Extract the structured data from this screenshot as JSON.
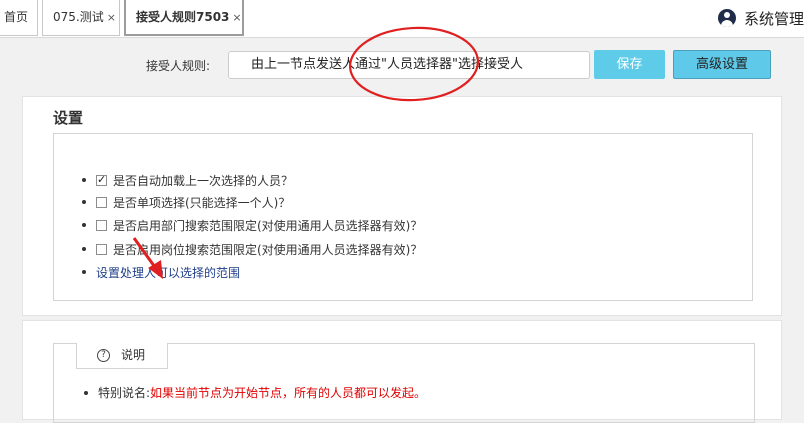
{
  "tabs": [
    {
      "label": "首页"
    },
    {
      "label": "075.测试",
      "close": "×"
    },
    {
      "label": "接受人规则7503",
      "close": "×"
    }
  ],
  "user": {
    "name": "系统管理"
  },
  "rule": {
    "label": "接受人规则:",
    "value": "由上一节点发送人通过\"人员选择器\"选择接受人"
  },
  "buttons": {
    "save": "保存",
    "advanced": "高级设置"
  },
  "settings": {
    "title": "设置",
    "options": [
      {
        "label": "是否自动加载上一次选择的人员？",
        "checked": true
      },
      {
        "label": "是否单项选择(只能选择一个人)？",
        "checked": false
      },
      {
        "label": "是否启用部门搜索范围限定(对使用通用人员选择器有效)？",
        "checked": false
      },
      {
        "label": "是否启用岗位搜索范围限定(对使用通用人员选择器有效)？",
        "checked": false
      }
    ],
    "range_link": "设置处理人可以选择的范围"
  },
  "notes": {
    "tab_label": "说明",
    "icon": "question-icon",
    "special_label": "特别说名:",
    "special_text": "如果当前节点为开始节点，所有的人员都可以发起。"
  },
  "colors": {
    "save_bg": "#5ecbe8",
    "advanced_bg": "#5ec9e8",
    "annotation": "#e02020",
    "note_red": "#e00000"
  }
}
